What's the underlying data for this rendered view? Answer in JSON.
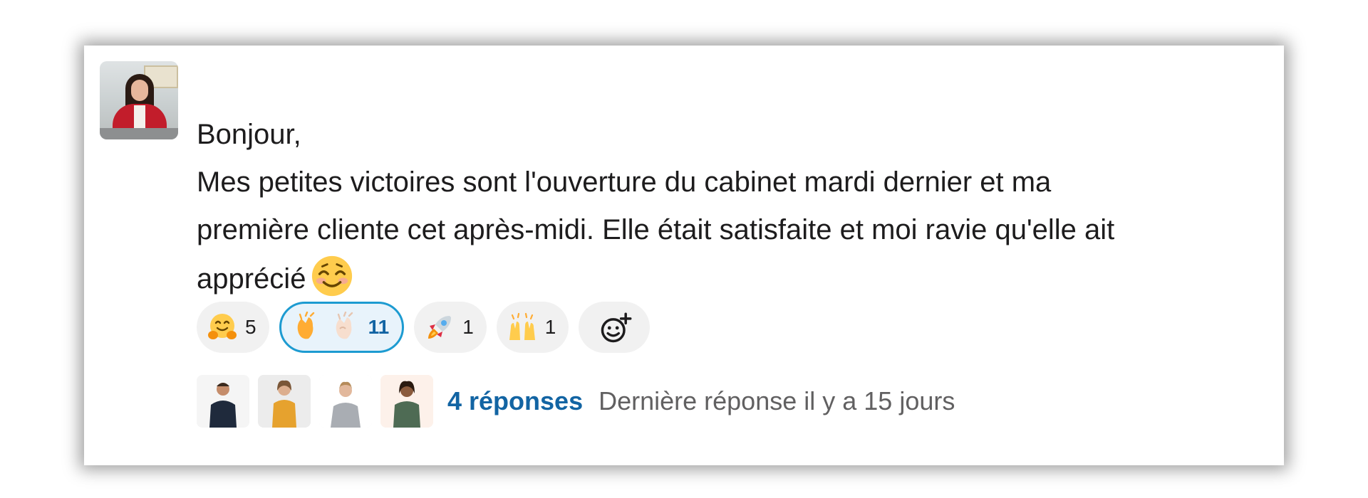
{
  "message": {
    "lines": [
      "Bonjour,",
      "Mes petites victoires sont l'ouverture du cabinet mardi dernier et ma",
      "première cliente cet après-midi. Elle était satisfaite et moi ravie qu'elle ait",
      "apprécié"
    ],
    "trailing_emoji": "smiling-face-with-smiling-eyes"
  },
  "reactions": [
    {
      "emoji": "hugging-face",
      "count": "5",
      "active": false
    },
    {
      "emoji": "clapping-hands",
      "count": "11",
      "active": true
    },
    {
      "emoji": "rocket",
      "count": "1",
      "active": false
    },
    {
      "emoji": "raising-hands",
      "count": "1",
      "active": false
    }
  ],
  "add_reaction_icon": "add-reaction-icon",
  "thread": {
    "replies_label": "4 réponses",
    "last_reply_label": "Dernière réponse il y a 15 jours"
  },
  "colors": {
    "link": "#1264a3",
    "active_border": "#1d9bd1",
    "active_bg": "#e8f3fb",
    "pill_bg": "#f1f1f1",
    "muted_text": "#616061"
  }
}
